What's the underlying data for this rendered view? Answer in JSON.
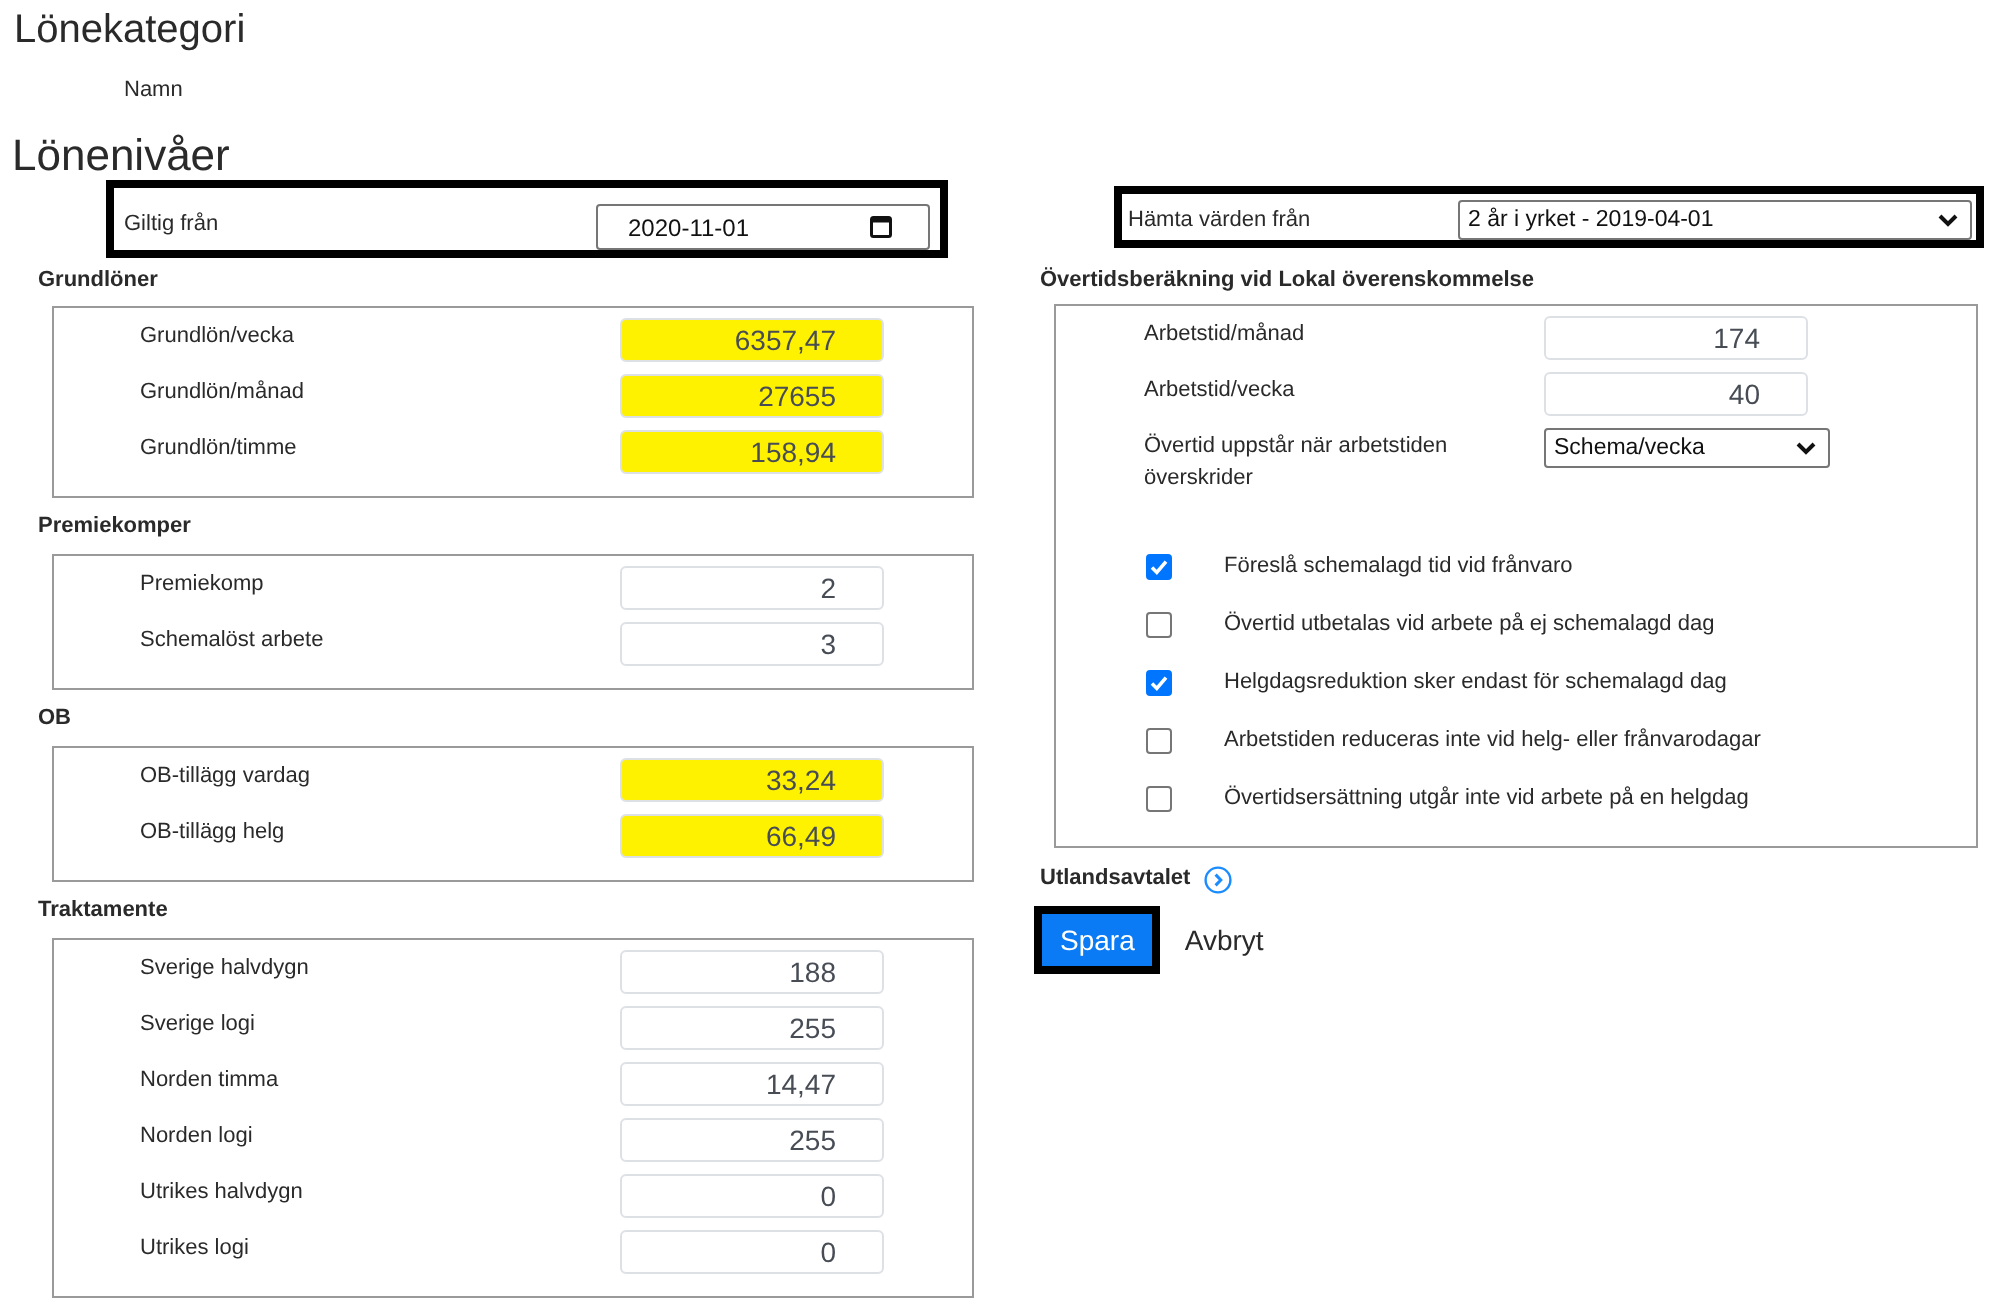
{
  "page_title": "Lönekategori",
  "name_field": {
    "label": "Namn"
  },
  "levels_title": "Lönenivåer",
  "valid_from": {
    "label": "Giltig från",
    "value": "2020-11-01",
    "outlined": true
  },
  "fetch_from": {
    "label": "Hämta värden från",
    "value": "2 år i yrket - 2019-04-01",
    "outlined": true
  },
  "left_sections": [
    {
      "title": "Grundlöner",
      "fields": [
        {
          "label": "Grundlön/vecka",
          "value": "6357,47",
          "highlighted": true
        },
        {
          "label": "Grundlön/månad",
          "value": "27655",
          "highlighted": true
        },
        {
          "label": "Grundlön/timme",
          "value": "158,94",
          "highlighted": true
        }
      ]
    },
    {
      "title": "Premiekomper",
      "fields": [
        {
          "label": "Premiekomp",
          "value": "2",
          "highlighted": false
        },
        {
          "label": "Schemalöst arbete",
          "value": "3",
          "highlighted": false
        }
      ]
    },
    {
      "title": "OB",
      "fields": [
        {
          "label": "OB-tillägg vardag",
          "value": "33,24",
          "highlighted": true
        },
        {
          "label": "OB-tillägg helg",
          "value": "66,49",
          "highlighted": true
        }
      ]
    },
    {
      "title": "Traktamente",
      "fields": [
        {
          "label": "Sverige halvdygn",
          "value": "188",
          "highlighted": false
        },
        {
          "label": "Sverige logi",
          "value": "255",
          "highlighted": false
        },
        {
          "label": "Norden timma",
          "value": "14,47",
          "highlighted": false
        },
        {
          "label": "Norden logi",
          "value": "255",
          "highlighted": false
        },
        {
          "label": "Utrikes halvdygn",
          "value": "0",
          "highlighted": false
        },
        {
          "label": "Utrikes logi",
          "value": "0",
          "highlighted": false
        }
      ]
    }
  ],
  "overtime": {
    "title": "Övertidsberäkning vid Lokal överenskommelse",
    "fields": [
      {
        "kind": "input",
        "label": "Arbetstid/månad",
        "value": "174"
      },
      {
        "kind": "input",
        "label": "Arbetstid/vecka",
        "value": "40"
      },
      {
        "kind": "select",
        "label": "Övertid uppstår när arbetstiden överskrider",
        "value": "Schema/vecka"
      }
    ],
    "options": [
      {
        "label": "Föreslå schemalagd tid vid frånvaro",
        "checked": true
      },
      {
        "label": "Övertid utbetalas vid arbete på ej schemalagd dag",
        "checked": false
      },
      {
        "label": "Helgdagsreduktion sker endast för schemalagd dag",
        "checked": true
      },
      {
        "label": "Arbetstiden reduceras inte vid helg- eller frånvarodagar",
        "checked": false
      },
      {
        "label": "Övertidsersättning utgår inte vid arbete på en helgdag",
        "checked": false
      }
    ]
  },
  "abroad": {
    "title": "Utlandsavtalet",
    "expanded": false
  },
  "buttons": [
    {
      "kind": "primary",
      "label": "Spara",
      "outlined": true
    },
    {
      "kind": "link",
      "label": "Avbryt",
      "outlined": false
    }
  ]
}
